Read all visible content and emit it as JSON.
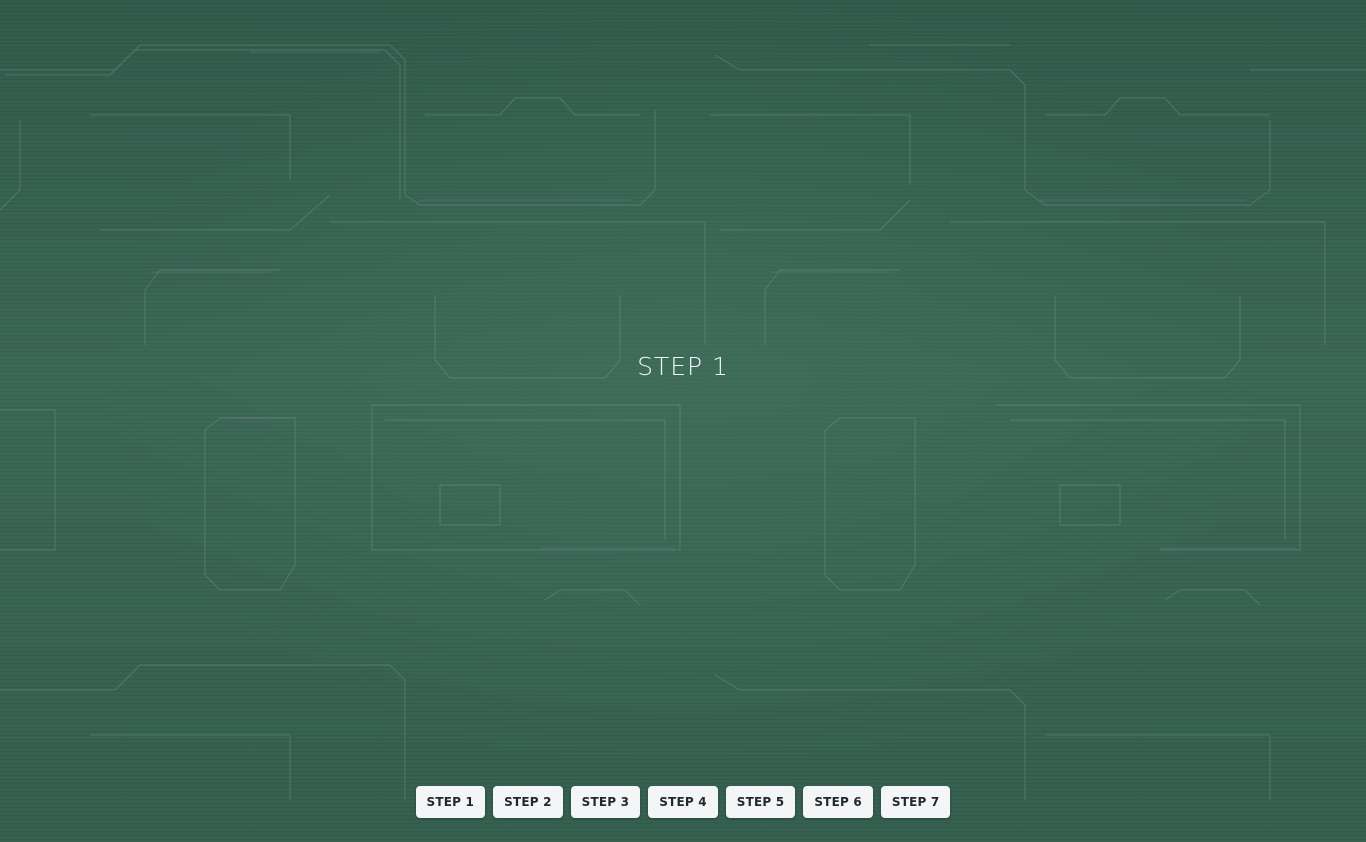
{
  "slide": {
    "title": "STEP 1"
  },
  "nav": {
    "steps": [
      "STEP 1",
      "STEP 2",
      "STEP 3",
      "STEP 4",
      "STEP 5",
      "STEP 6",
      "STEP 7"
    ]
  },
  "background": {
    "type": "circuit-board-pattern",
    "base_color": "#356050",
    "trace_color": "#7fa696",
    "accent_trace_color": "#9a7fa0"
  }
}
